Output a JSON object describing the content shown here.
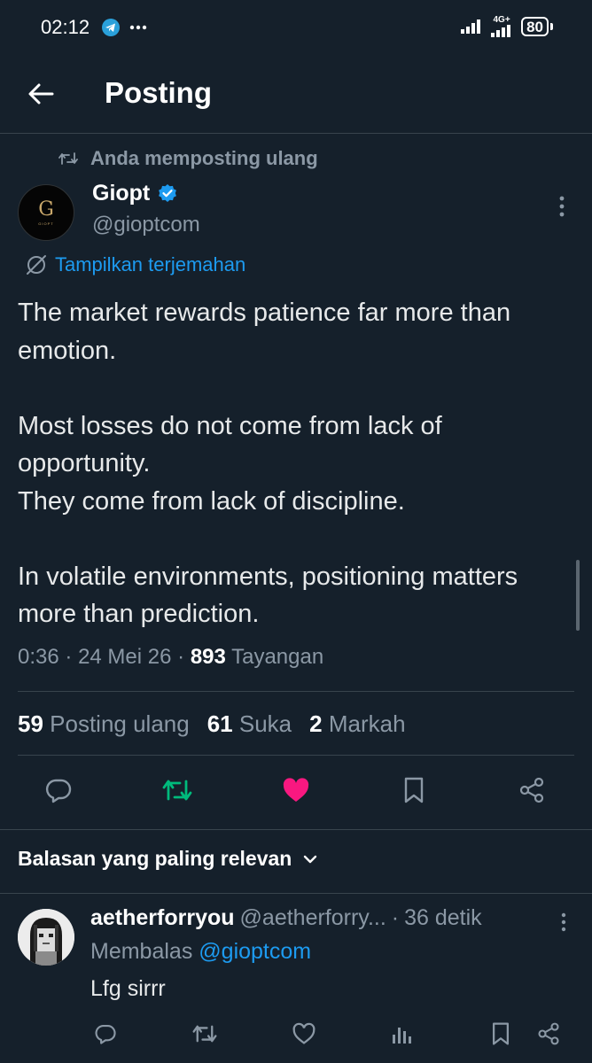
{
  "status_bar": {
    "time": "02:12",
    "network_label": "4G+",
    "battery": "80"
  },
  "header": {
    "title": "Posting"
  },
  "post": {
    "repost_label": "Anda memposting ulang",
    "author_name": "Giopt",
    "author_handle": "@gioptcom",
    "avatar_letter": "G",
    "avatar_sublabel": "GIOPT",
    "translate_label": "Tampilkan terjemahan",
    "body": [
      "The market rewards patience far more than emotion.",
      "",
      "Most losses do not come from lack of opportunity.",
      "They come from lack of discipline.",
      "",
      "In volatile environments, positioning matters more than prediction."
    ],
    "time": "0:36",
    "date": "24 Mei 26",
    "views_count": "893",
    "views_label": "Tayangan",
    "reposts_count": "59",
    "reposts_label": "Posting ulang",
    "likes_count": "61",
    "likes_label": "Suka",
    "bookmarks_count": "2",
    "bookmarks_label": "Markah"
  },
  "replies_section": {
    "sort_label": "Balasan yang paling relevan"
  },
  "reply": {
    "name": "aetherforryou",
    "handle": "@aetherforry...",
    "time": "36 detik",
    "replying_label": "Membalas",
    "replying_to": "@gioptcom",
    "text": "Lfg sirrr"
  },
  "colors": {
    "background": "#15202b",
    "accent": "#1d9bf0",
    "repost_active": "#00ba7c",
    "like_active": "#f91880",
    "muted": "#8b98a5"
  },
  "icons": {
    "back": "arrow-left-icon",
    "verified": "verified-badge-icon",
    "more": "more-vertical-icon",
    "translate": "translate-icon",
    "reply": "reply-icon",
    "repost": "repost-icon",
    "like": "heart-icon",
    "bookmark": "bookmark-icon",
    "share": "share-icon",
    "views": "views-icon",
    "chevron": "chevron-down-icon"
  }
}
